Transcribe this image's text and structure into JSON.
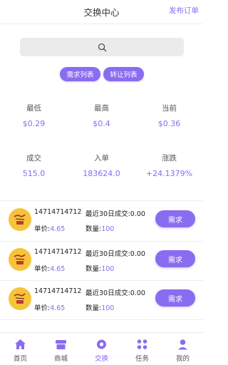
{
  "header": {
    "title": "交换中心",
    "publish_label": "发布订单"
  },
  "search": {
    "icon": "search-icon"
  },
  "filters": {
    "demand_label": "需求列表",
    "transfer_label": "转让列表"
  },
  "stats": {
    "low": {
      "label": "最低",
      "value": "$0.29"
    },
    "high": {
      "label": "最高",
      "value": "$0.4"
    },
    "current": {
      "label": "当前",
      "value": "$0.36"
    },
    "deal": {
      "label": "成交",
      "value": "515.0"
    },
    "entry": {
      "label": "入单",
      "value": "183624.0"
    },
    "change": {
      "label": "涨跌",
      "value": "+24.1379%"
    }
  },
  "orders": [
    {
      "phone": "14714714712",
      "recent_label": "最近30日成交:",
      "recent_value": "0.00",
      "price_label": "单价:",
      "price": "4.65",
      "qty_label": "数量:",
      "qty": "100",
      "button": "需求"
    },
    {
      "phone": "14714714712",
      "recent_label": "最近30日成交:",
      "recent_value": "0.00",
      "price_label": "单价:",
      "price": "4.65",
      "qty_label": "数量:",
      "qty": "100",
      "button": "需求"
    },
    {
      "phone": "14714714712",
      "recent_label": "最近30日成交:",
      "recent_value": "0.00",
      "price_label": "单价:",
      "price": "4.65",
      "qty_label": "数量:",
      "qty": "100",
      "button": "需求"
    }
  ],
  "tabs": [
    {
      "label": "首页",
      "icon": "home-icon"
    },
    {
      "label": "商城",
      "icon": "shop-icon"
    },
    {
      "label": "交换",
      "icon": "exchange-icon",
      "active": true
    },
    {
      "label": "任务",
      "icon": "tasks-icon"
    },
    {
      "label": "我的",
      "icon": "profile-icon"
    }
  ],
  "colors": {
    "accent": "#8a6cf0",
    "avatar": "#f6c33a",
    "text": "#333333"
  }
}
